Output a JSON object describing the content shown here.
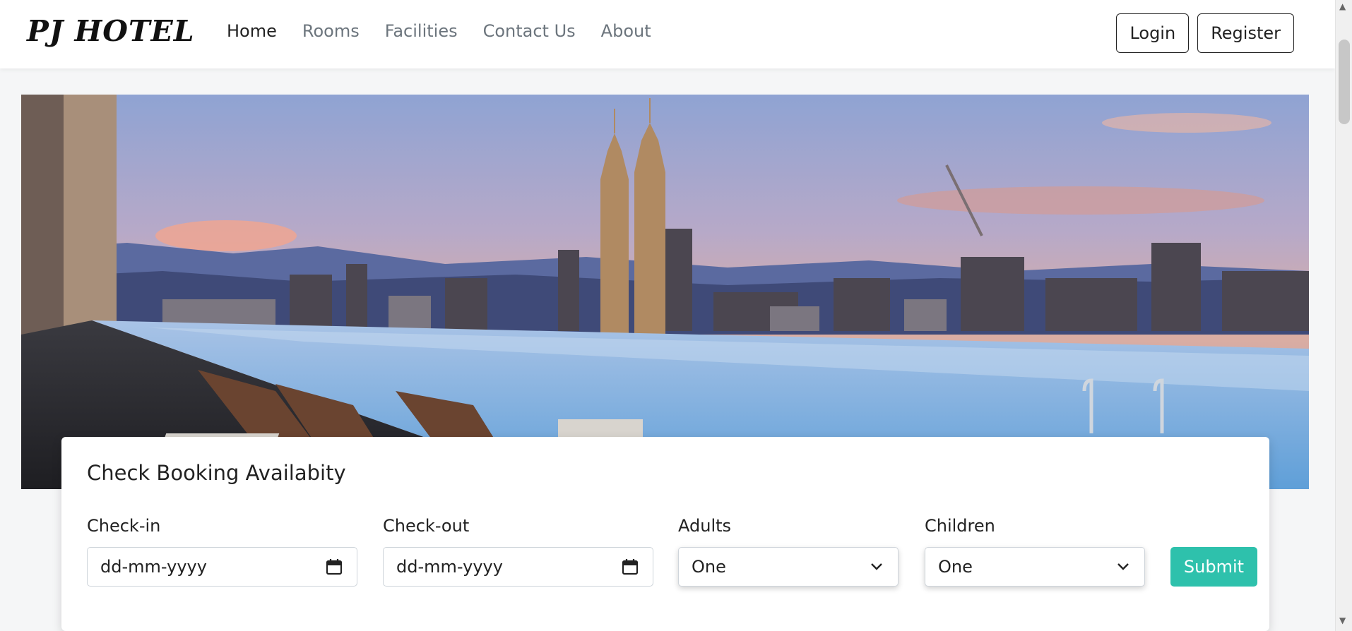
{
  "brand": "PJ HOTEL",
  "nav": {
    "items": [
      {
        "label": "Home",
        "active": true
      },
      {
        "label": "Rooms",
        "active": false
      },
      {
        "label": "Facilities",
        "active": false
      },
      {
        "label": "Contact Us",
        "active": false
      },
      {
        "label": "About",
        "active": false
      }
    ]
  },
  "auth": {
    "login_label": "Login",
    "register_label": "Register"
  },
  "booking": {
    "title": "Check Booking Availabity",
    "checkin": {
      "label": "Check-in",
      "placeholder": "dd-mm-yyyy"
    },
    "checkout": {
      "label": "Check-out",
      "placeholder": "dd-mm-yyyy"
    },
    "adults": {
      "label": "Adults",
      "value": "One"
    },
    "children": {
      "label": "Children",
      "value": "One"
    },
    "submit_label": "Submit"
  },
  "colors": {
    "accent": "#2ec1ac"
  },
  "icons": {
    "date": "calendar-icon",
    "select": "chevron-down-icon"
  }
}
